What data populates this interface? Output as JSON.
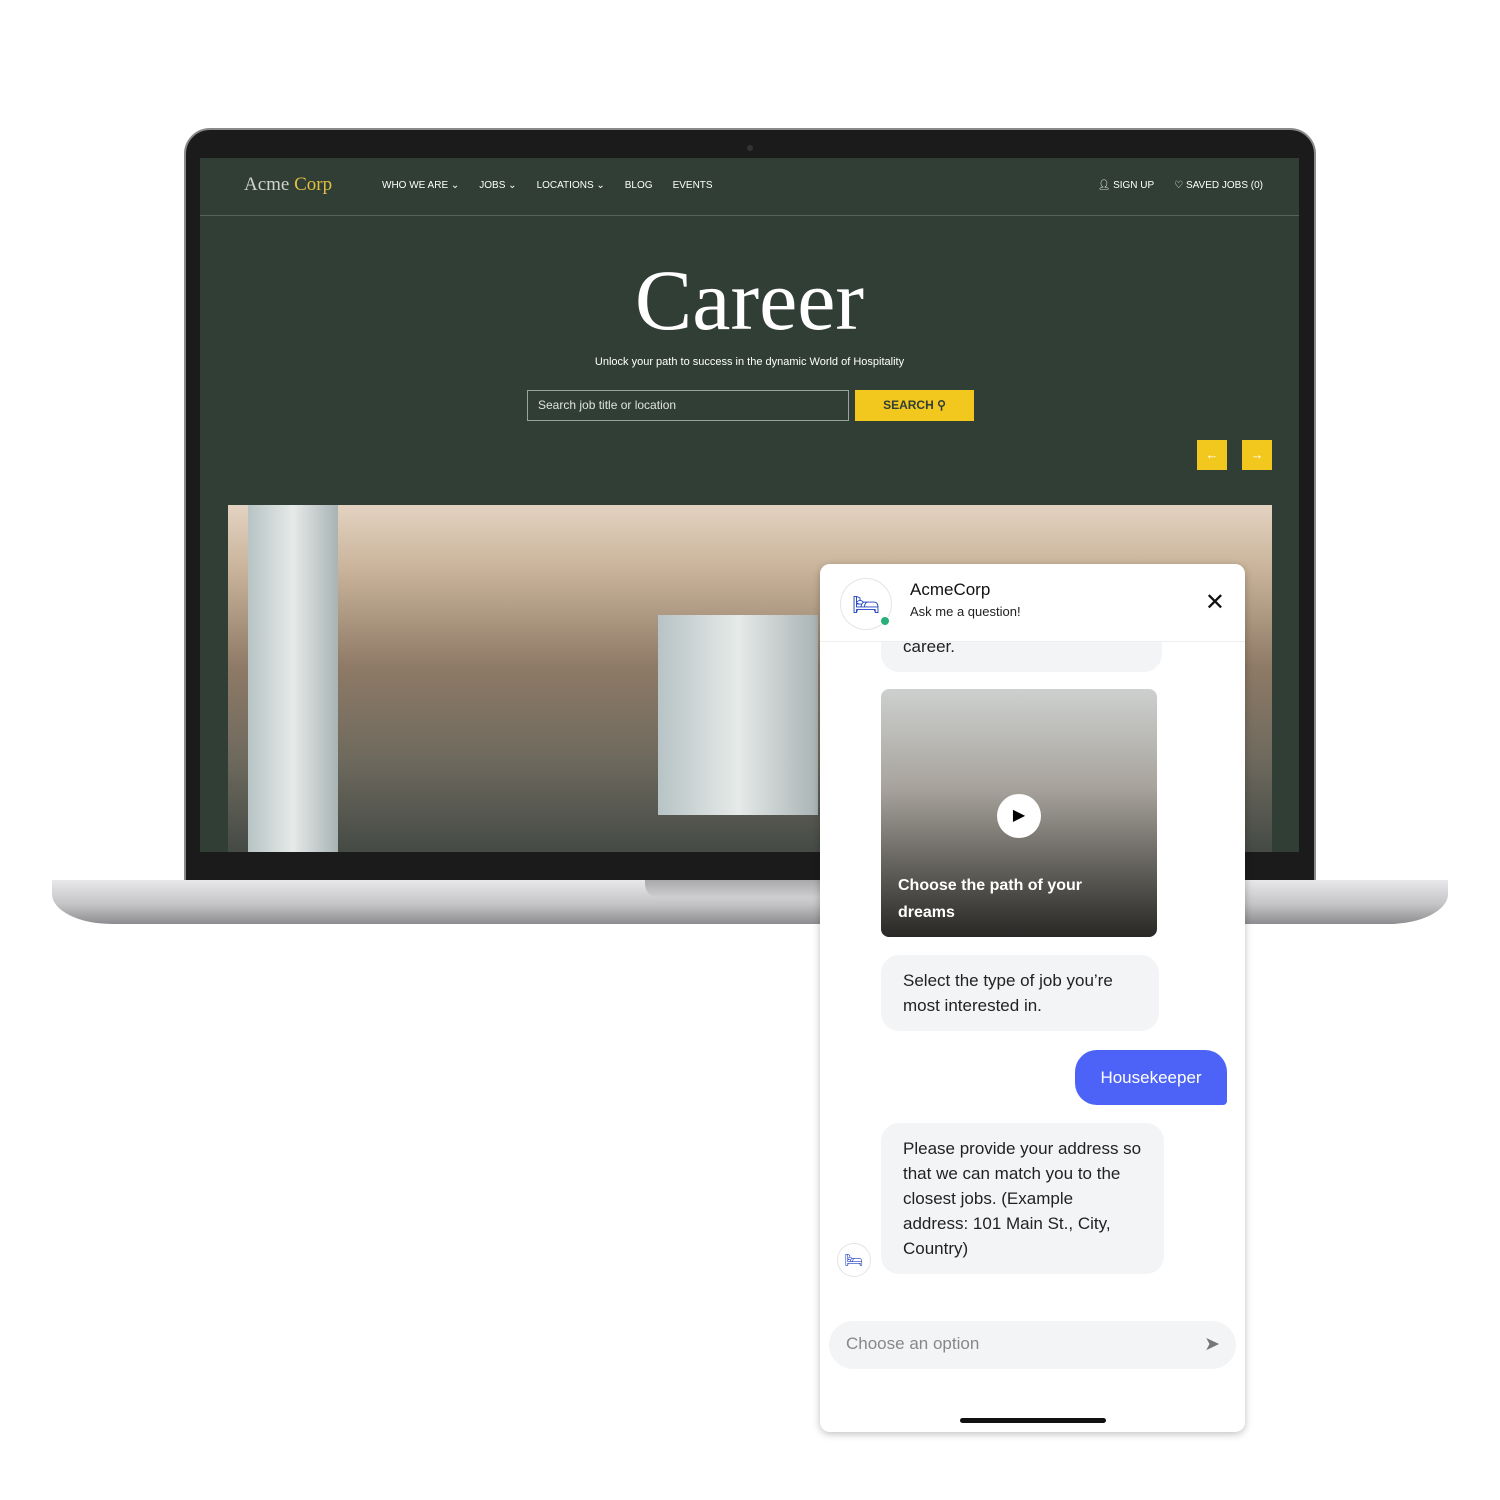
{
  "site": {
    "logo_a": "Acme",
    "logo_b": "Corp",
    "nav": [
      "WHO WE ARE ⌄",
      "JOBS ⌄",
      "LOCATIONS ⌄",
      "BLOG",
      "EVENTS"
    ],
    "sign_up": "SIGN UP",
    "saved_jobs": "SAVED JOBS (0)",
    "title": "Career",
    "subtitle": "Unlock your path to success in the dynamic World of Hospitality",
    "search_placeholder": "Search job title or location",
    "search_button": "SEARCH"
  },
  "chat": {
    "name": "AcmeCorp",
    "status": "Ask me a question!",
    "partial_message": "career.",
    "video_caption": "Choose the path of your dreams",
    "msg_select": "Select the type of job you’re most interested in.",
    "user_reply": "Housekeeper",
    "msg_address": "Please provide your address so that we can match you to the closest jobs. (Example address: 101 Main St., City, Country)",
    "input_placeholder": "Choose an option"
  },
  "colors": {
    "brand_green": "#313e36",
    "accent_yellow": "#f2c81f",
    "user_bubble": "#4d63f7"
  }
}
